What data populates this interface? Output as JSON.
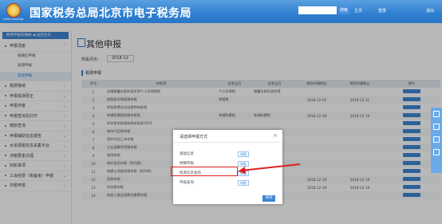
{
  "header": {
    "title": "国家税务总局北京市电子税务局",
    "logo_text": "CHINA TAXATION",
    "search_button": "搜索",
    "nav_home": "主页",
    "nav_user": "登录",
    "nav_exit": "退出",
    "accent": "#2f7fd0"
  },
  "sidebar": {
    "top_bar": "税费申报及缴纳  ◀  返回主页",
    "items": [
      {
        "label": "申报清册",
        "expanded": true,
        "subs": [
          "按期应申报",
          "逾期申报",
          "其他申报"
        ],
        "active": "其他申报"
      },
      {
        "label": "税费缴纳"
      },
      {
        "label": "申报错误更正"
      },
      {
        "label": "申报作废"
      },
      {
        "label": "申报查询及打印"
      },
      {
        "label": "缴款查询"
      },
      {
        "label": "申报辅助信息报告"
      },
      {
        "label": "水资源税信息采集平台"
      },
      {
        "label": "涉税要素办理"
      },
      {
        "label": "四如事项"
      },
      {
        "label": "工会经费（筹备金）申报"
      },
      {
        "label": "非税申报"
      }
    ]
  },
  "main": {
    "title": "其他申报",
    "period_label": "所属月份：",
    "period_value": "2018-12",
    "section": "税费申报",
    "columns": [
      "序号",
      "申报表",
      "征收品目",
      "征收品目",
      "税款所属期起",
      "税款所属期止",
      "操作"
    ],
    "rows": [
      [
        "1",
        "扣缴储蓄存款利息所得个人所得税报",
        "个人所得税",
        "储蓄存款利息所得",
        "",
        "",
        ""
      ],
      [
        "2",
        "借款股份增值税申报",
        "增值税",
        "",
        "2018-12-01",
        "2018-12-31",
        ""
      ],
      [
        "3",
        "附加税费及同自税种申报表",
        "",
        "",
        "",
        "",
        ""
      ],
      [
        "4",
        "车辆购置税纳税申报表",
        "车辆购置税",
        "车辆购置税",
        "2018-12-19",
        "2018-12-19",
        ""
      ],
      [
        "5",
        "印花税申报表纳税申报表2015",
        "",
        "",
        "",
        "",
        ""
      ],
      [
        "6",
        "城市代征税申报",
        "",
        "",
        "",
        "",
        ""
      ],
      [
        "7",
        "国外代征汇市申报",
        "",
        "",
        "",
        "",
        ""
      ],
      [
        "8",
        "企业清算所得税申报",
        "",
        "",
        "",
        "",
        ""
      ],
      [
        "9",
        "通用申报",
        "",
        "",
        "",
        "",
        ""
      ],
      [
        "10",
        "城乡居民申报（附列表）",
        "",
        "",
        "",
        "",
        ""
      ],
      [
        "11",
        "城建土地使用税申报（附列表）",
        "",
        "",
        "",
        "",
        ""
      ],
      [
        "12",
        "契税申报",
        "车辆购置税",
        "",
        "2018-12-19",
        "2018-12-19",
        ""
      ],
      [
        "13",
        "印花税申报",
        "",
        "",
        "2018-12-19",
        "2018-12-19",
        ""
      ],
      [
        "14",
        "残疾人就业保障金缴费申报",
        "残疾人就业保障金",
        "",
        "",
        "",
        ""
      ]
    ],
    "op_label": "申报表查看"
  },
  "dialog": {
    "title": "请选择申报方式",
    "options": [
      {
        "label": "基础信息",
        "btn": "申报"
      },
      {
        "label": "明细申报",
        "btn": "申报"
      },
      {
        "label": "税源信息查询",
        "btn": "申报"
      },
      {
        "label": "申报查询",
        "btn": "申报"
      }
    ],
    "ok": "关闭",
    "highlight": "税源信息查询"
  },
  "annotation": {
    "color": "#e02020"
  }
}
